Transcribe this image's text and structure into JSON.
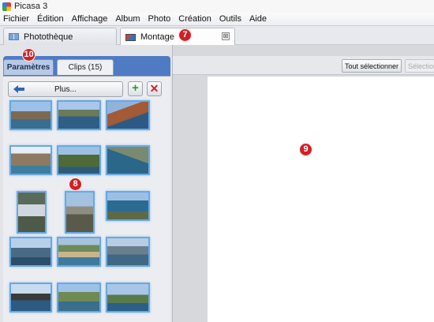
{
  "window": {
    "title": "Picasa 3"
  },
  "menu": [
    "Fichier",
    "Édition",
    "Affichage",
    "Album",
    "Photo",
    "Création",
    "Outils",
    "Aide"
  ],
  "tabs": {
    "library": {
      "label": "Photothèque"
    },
    "montage": {
      "label": "Montage",
      "close": "⊠"
    }
  },
  "panel": {
    "params_tab": "Paramètres",
    "clips_tab": "Clips (15)",
    "more_button": "Plus...",
    "add_symbol": "+",
    "remove_symbol": "✕"
  },
  "toolbar": {
    "select_all": "Tout sélectionner",
    "select_partial": "Sélection"
  },
  "badges": {
    "montage_tab": "7",
    "clip": "8",
    "canvas": "9",
    "params_tab": "10"
  },
  "icons": {
    "app": "picasa-logo-icon",
    "library": "grid-icon",
    "montage": "collage-icon",
    "back": "arrow-left-icon"
  },
  "clips": {
    "count": 15,
    "items": [
      "clip-1",
      "clip-2",
      "clip-3",
      "clip-4",
      "clip-5",
      "clip-6",
      "clip-7",
      "clip-8",
      "clip-9",
      "clip-10",
      "clip-11",
      "clip-12",
      "clip-13",
      "clip-14",
      "clip-15"
    ]
  },
  "colors": {
    "panel_blue": "#4f7ac4",
    "thumb_border": "#6aa8e0",
    "badge_red": "#d21f25"
  }
}
